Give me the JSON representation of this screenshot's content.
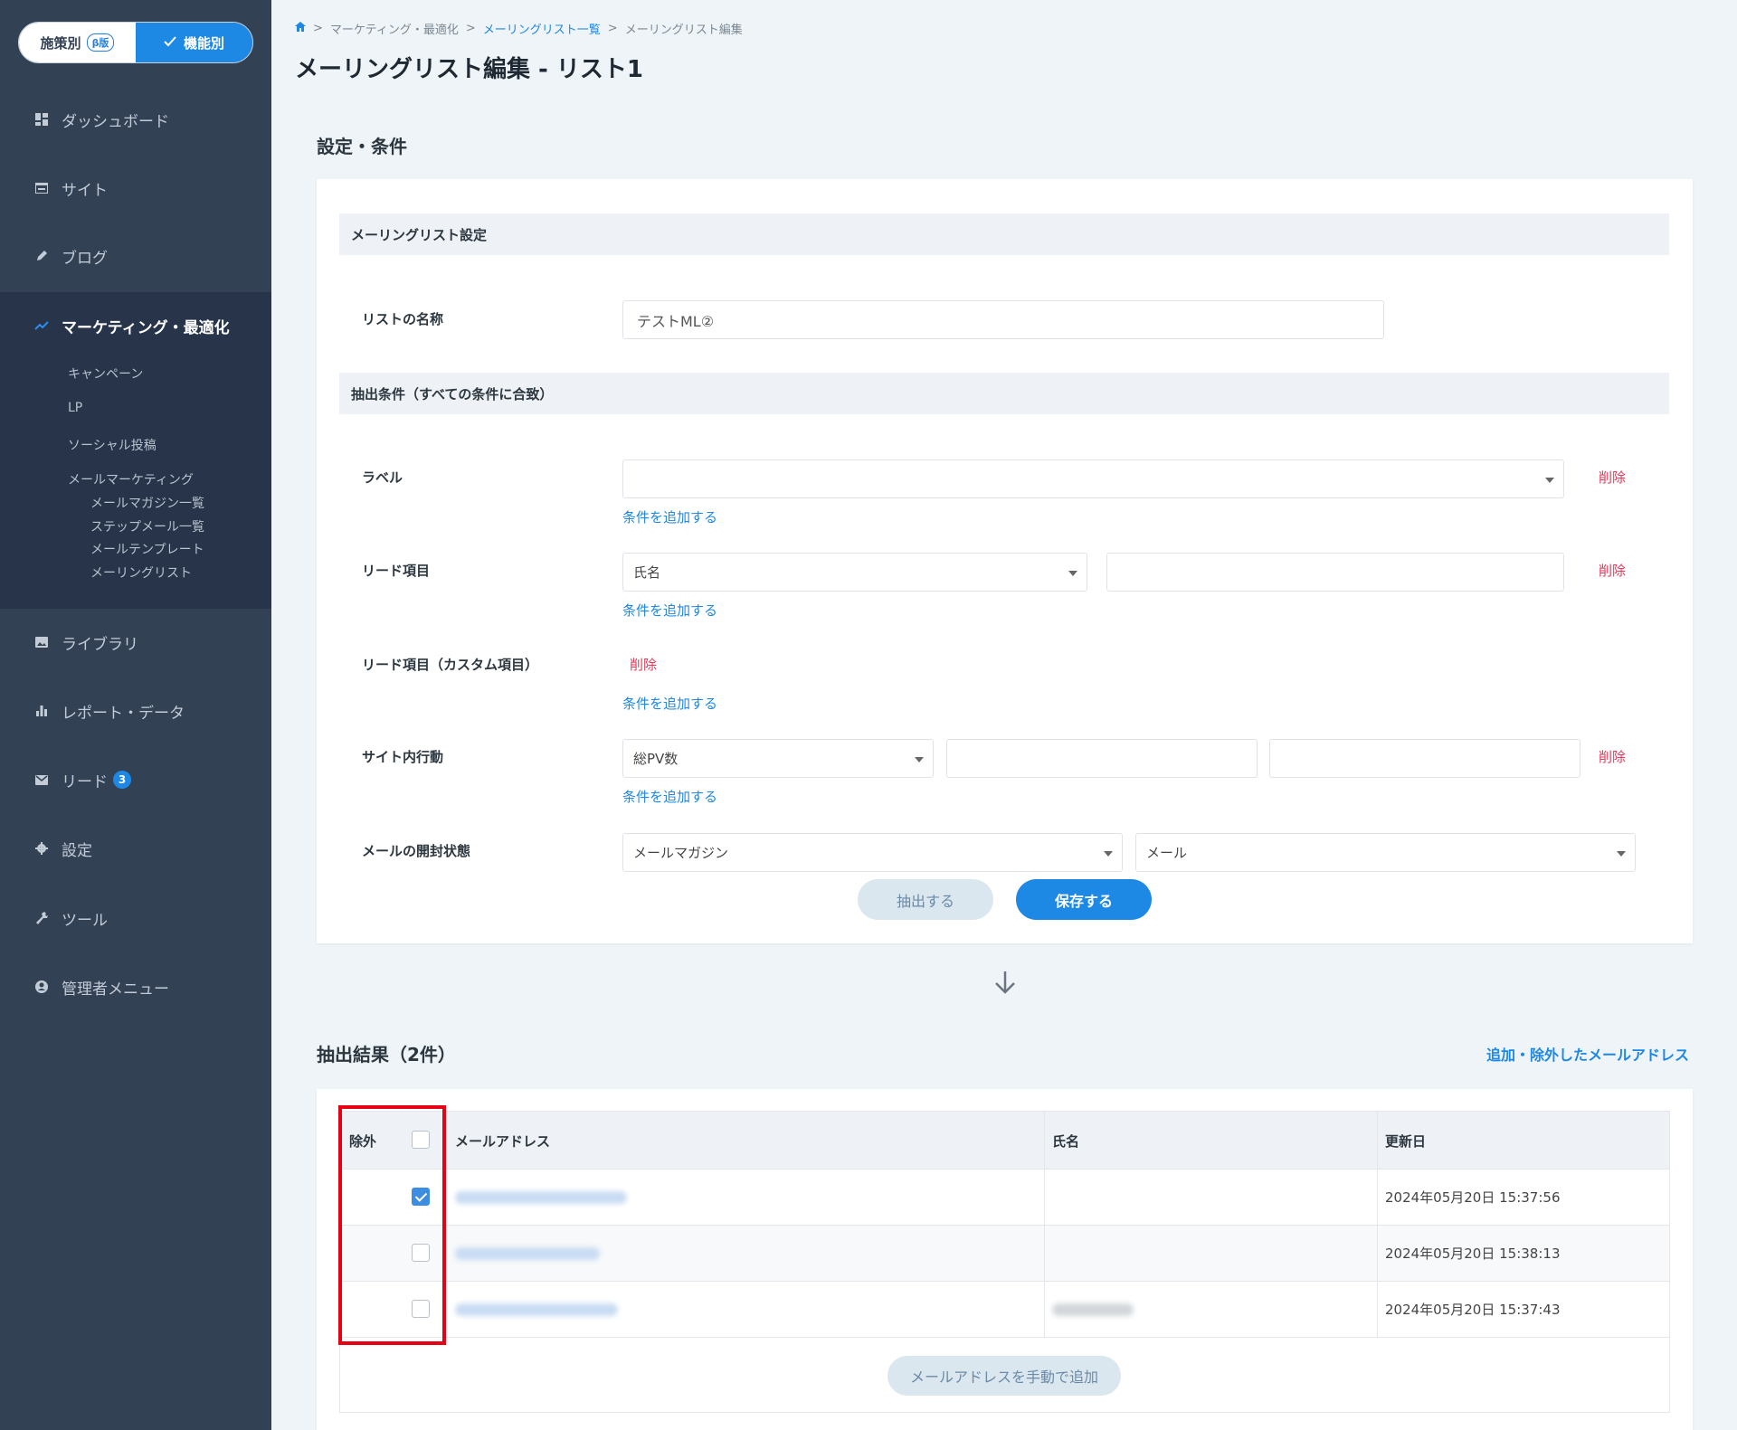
{
  "sidebar": {
    "toggle": {
      "left": "施策別",
      "beta": "β版",
      "right": "機能別"
    },
    "nav": [
      {
        "label": "ダッシュボード",
        "icon": "dashboard-icon"
      },
      {
        "label": "サイト",
        "icon": "site-icon"
      },
      {
        "label": "ブログ",
        "icon": "pencil-icon"
      },
      {
        "label": "マーケティング・最適化",
        "icon": "trend-icon"
      },
      {
        "label": "ライブラリ",
        "icon": "image-icon"
      },
      {
        "label": "レポート・データ",
        "icon": "bar-chart-icon"
      },
      {
        "label": "リード",
        "icon": "mail-icon",
        "badge": "3"
      },
      {
        "label": "設定",
        "icon": "gear-icon"
      },
      {
        "label": "ツール",
        "icon": "wrench-icon"
      },
      {
        "label": "管理者メニュー",
        "icon": "user-icon"
      }
    ],
    "sub": [
      "キャンペーン",
      "LP",
      "ソーシャル投稿",
      "メールマーケティング"
    ],
    "subsub": [
      "メールマガジン一覧",
      "ステップメール一覧",
      "メールテンプレート",
      "メーリングリスト"
    ]
  },
  "breadcrumb": {
    "b1": "マーケティング・最適化",
    "b2": "メーリングリスト一覧",
    "b3": "メーリングリスト編集"
  },
  "page_title": "メーリングリスト編集 - リスト1",
  "section_settings": "設定・条件",
  "card": {
    "header1": "メーリングリスト設定",
    "list_name_label": "リストの名称",
    "list_name_value": "テストML②",
    "header2": "抽出条件（すべての条件に合致）",
    "label_label": "ラベル",
    "lead_label": "リード項目",
    "lead_select": "氏名",
    "custom_label": "リード項目（カスタム項目）",
    "site_label": "サイト内行動",
    "site_select": "総PV数",
    "mail_label": "メールの開封状態",
    "mail_select1": "メールマガジン",
    "mail_select2": "メール",
    "delete": "削除",
    "add_condition": "条件を追加する",
    "extract_button": "抽出する",
    "save_button": "保存する"
  },
  "results": {
    "title": "抽出結果（2件）",
    "link": "追加・除外したメールアドレス",
    "headers": {
      "exclude": "除外",
      "email": "メールアドレス",
      "name": "氏名",
      "updated": "更新日"
    },
    "rows": [
      {
        "checked": true,
        "date": "2024年05月20日  15:37:56"
      },
      {
        "checked": false,
        "date": "2024年05月20日  15:38:13"
      },
      {
        "checked": false,
        "date": "2024年05月20日  15:37:43"
      }
    ],
    "manual_add": "メールアドレスを手動で追加"
  }
}
